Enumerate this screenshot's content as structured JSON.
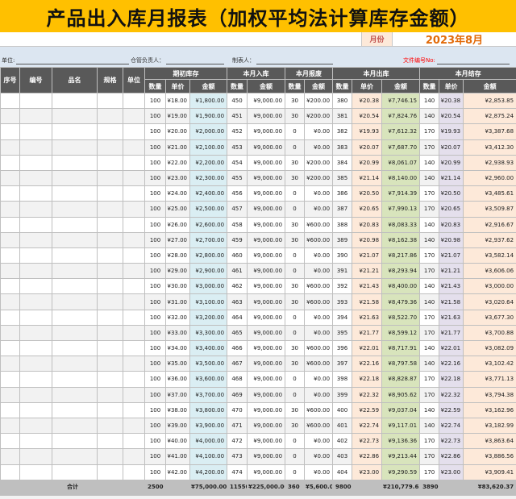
{
  "title": "产品出入库月报表（加权平均法计算库存金额）",
  "month": {
    "label": "月份",
    "value": "2023年8月"
  },
  "info": {
    "unit_label": "单位:",
    "warehouse_label": "仓管负责人：",
    "preparer_label": "制表人：",
    "doc_no_label": "文件编号No:"
  },
  "headers": {
    "seq": "序号",
    "code": "编号",
    "name": "品名",
    "spec": "规格",
    "unit": "单位",
    "begin": "期初库存",
    "in": "本月入库",
    "scrap": "本月报废",
    "out": "本月出库",
    "end": "本月结存",
    "qty": "数量",
    "price": "单价",
    "amount": "金额"
  },
  "rows": [
    {
      "bq": "100",
      "bp": "¥18.00",
      "ba": "¥1,800.00",
      "iq": "450",
      "ia": "¥9,000.00",
      "sq": "30",
      "sa": "¥200.00",
      "oq": "380",
      "op": "¥20.38",
      "oa": "¥7,746.15",
      "eq": "140",
      "ep": "¥20.38",
      "ea": "¥2,853.85"
    },
    {
      "bq": "100",
      "bp": "¥19.00",
      "ba": "¥1,900.00",
      "iq": "451",
      "ia": "¥9,000.00",
      "sq": "30",
      "sa": "¥200.00",
      "oq": "381",
      "op": "¥20.54",
      "oa": "¥7,824.76",
      "eq": "140",
      "ep": "¥20.54",
      "ea": "¥2,875.24"
    },
    {
      "bq": "100",
      "bp": "¥20.00",
      "ba": "¥2,000.00",
      "iq": "452",
      "ia": "¥9,000.00",
      "sq": "0",
      "sa": "¥0.00",
      "oq": "382",
      "op": "¥19.93",
      "oa": "¥7,612.32",
      "eq": "170",
      "ep": "¥19.93",
      "ea": "¥3,387.68"
    },
    {
      "bq": "100",
      "bp": "¥21.00",
      "ba": "¥2,100.00",
      "iq": "453",
      "ia": "¥9,000.00",
      "sq": "0",
      "sa": "¥0.00",
      "oq": "383",
      "op": "¥20.07",
      "oa": "¥7,687.70",
      "eq": "170",
      "ep": "¥20.07",
      "ea": "¥3,412.30"
    },
    {
      "bq": "100",
      "bp": "¥22.00",
      "ba": "¥2,200.00",
      "iq": "454",
      "ia": "¥9,000.00",
      "sq": "30",
      "sa": "¥200.00",
      "oq": "384",
      "op": "¥20.99",
      "oa": "¥8,061.07",
      "eq": "140",
      "ep": "¥20.99",
      "ea": "¥2,938.93"
    },
    {
      "bq": "100",
      "bp": "¥23.00",
      "ba": "¥2,300.00",
      "iq": "455",
      "ia": "¥9,000.00",
      "sq": "30",
      "sa": "¥200.00",
      "oq": "385",
      "op": "¥21.14",
      "oa": "¥8,140.00",
      "eq": "140",
      "ep": "¥21.14",
      "ea": "¥2,960.00"
    },
    {
      "bq": "100",
      "bp": "¥24.00",
      "ba": "¥2,400.00",
      "iq": "456",
      "ia": "¥9,000.00",
      "sq": "0",
      "sa": "¥0.00",
      "oq": "386",
      "op": "¥20.50",
      "oa": "¥7,914.39",
      "eq": "170",
      "ep": "¥20.50",
      "ea": "¥3,485.61"
    },
    {
      "bq": "100",
      "bp": "¥25.00",
      "ba": "¥2,500.00",
      "iq": "457",
      "ia": "¥9,000.00",
      "sq": "0",
      "sa": "¥0.00",
      "oq": "387",
      "op": "¥20.65",
      "oa": "¥7,990.13",
      "eq": "170",
      "ep": "¥20.65",
      "ea": "¥3,509.87"
    },
    {
      "bq": "100",
      "bp": "¥26.00",
      "ba": "¥2,600.00",
      "iq": "458",
      "ia": "¥9,000.00",
      "sq": "30",
      "sa": "¥600.00",
      "oq": "388",
      "op": "¥20.83",
      "oa": "¥8,083.33",
      "eq": "140",
      "ep": "¥20.83",
      "ea": "¥2,916.67"
    },
    {
      "bq": "100",
      "bp": "¥27.00",
      "ba": "¥2,700.00",
      "iq": "459",
      "ia": "¥9,000.00",
      "sq": "30",
      "sa": "¥600.00",
      "oq": "389",
      "op": "¥20.98",
      "oa": "¥8,162.38",
      "eq": "140",
      "ep": "¥20.98",
      "ea": "¥2,937.62"
    },
    {
      "bq": "100",
      "bp": "¥28.00",
      "ba": "¥2,800.00",
      "iq": "460",
      "ia": "¥9,000.00",
      "sq": "0",
      "sa": "¥0.00",
      "oq": "390",
      "op": "¥21.07",
      "oa": "¥8,217.86",
      "eq": "170",
      "ep": "¥21.07",
      "ea": "¥3,582.14"
    },
    {
      "bq": "100",
      "bp": "¥29.00",
      "ba": "¥2,900.00",
      "iq": "461",
      "ia": "¥9,000.00",
      "sq": "0",
      "sa": "¥0.00",
      "oq": "391",
      "op": "¥21.21",
      "oa": "¥8,293.94",
      "eq": "170",
      "ep": "¥21.21",
      "ea": "¥3,606.06"
    },
    {
      "bq": "100",
      "bp": "¥30.00",
      "ba": "¥3,000.00",
      "iq": "462",
      "ia": "¥9,000.00",
      "sq": "30",
      "sa": "¥600.00",
      "oq": "392",
      "op": "¥21.43",
      "oa": "¥8,400.00",
      "eq": "140",
      "ep": "¥21.43",
      "ea": "¥3,000.00"
    },
    {
      "bq": "100",
      "bp": "¥31.00",
      "ba": "¥3,100.00",
      "iq": "463",
      "ia": "¥9,000.00",
      "sq": "30",
      "sa": "¥600.00",
      "oq": "393",
      "op": "¥21.58",
      "oa": "¥8,479.36",
      "eq": "140",
      "ep": "¥21.58",
      "ea": "¥3,020.64"
    },
    {
      "bq": "100",
      "bp": "¥32.00",
      "ba": "¥3,200.00",
      "iq": "464",
      "ia": "¥9,000.00",
      "sq": "0",
      "sa": "¥0.00",
      "oq": "394",
      "op": "¥21.63",
      "oa": "¥8,522.70",
      "eq": "170",
      "ep": "¥21.63",
      "ea": "¥3,677.30"
    },
    {
      "bq": "100",
      "bp": "¥33.00",
      "ba": "¥3,300.00",
      "iq": "465",
      "ia": "¥9,000.00",
      "sq": "0",
      "sa": "¥0.00",
      "oq": "395",
      "op": "¥21.77",
      "oa": "¥8,599.12",
      "eq": "170",
      "ep": "¥21.77",
      "ea": "¥3,700.88"
    },
    {
      "bq": "100",
      "bp": "¥34.00",
      "ba": "¥3,400.00",
      "iq": "466",
      "ia": "¥9,000.00",
      "sq": "30",
      "sa": "¥600.00",
      "oq": "396",
      "op": "¥22.01",
      "oa": "¥8,717.91",
      "eq": "140",
      "ep": "¥22.01",
      "ea": "¥3,082.09"
    },
    {
      "bq": "100",
      "bp": "¥35.00",
      "ba": "¥3,500.00",
      "iq": "467",
      "ia": "¥9,000.00",
      "sq": "30",
      "sa": "¥600.00",
      "oq": "397",
      "op": "¥22.16",
      "oa": "¥8,797.58",
      "eq": "140",
      "ep": "¥22.16",
      "ea": "¥3,102.42"
    },
    {
      "bq": "100",
      "bp": "¥36.00",
      "ba": "¥3,600.00",
      "iq": "468",
      "ia": "¥9,000.00",
      "sq": "0",
      "sa": "¥0.00",
      "oq": "398",
      "op": "¥22.18",
      "oa": "¥8,828.87",
      "eq": "170",
      "ep": "¥22.18",
      "ea": "¥3,771.13"
    },
    {
      "bq": "100",
      "bp": "¥37.00",
      "ba": "¥3,700.00",
      "iq": "469",
      "ia": "¥9,000.00",
      "sq": "0",
      "sa": "¥0.00",
      "oq": "399",
      "op": "¥22.32",
      "oa": "¥8,905.62",
      "eq": "170",
      "ep": "¥22.32",
      "ea": "¥3,794.38"
    },
    {
      "bq": "100",
      "bp": "¥38.00",
      "ba": "¥3,800.00",
      "iq": "470",
      "ia": "¥9,000.00",
      "sq": "30",
      "sa": "¥600.00",
      "oq": "400",
      "op": "¥22.59",
      "oa": "¥9,037.04",
      "eq": "140",
      "ep": "¥22.59",
      "ea": "¥3,162.96"
    },
    {
      "bq": "100",
      "bp": "¥39.00",
      "ba": "¥3,900.00",
      "iq": "471",
      "ia": "¥9,000.00",
      "sq": "30",
      "sa": "¥600.00",
      "oq": "401",
      "op": "¥22.74",
      "oa": "¥9,117.01",
      "eq": "140",
      "ep": "¥22.74",
      "ea": "¥3,182.99"
    },
    {
      "bq": "100",
      "bp": "¥40.00",
      "ba": "¥4,000.00",
      "iq": "472",
      "ia": "¥9,000.00",
      "sq": "0",
      "sa": "¥0.00",
      "oq": "402",
      "op": "¥22.73",
      "oa": "¥9,136.36",
      "eq": "170",
      "ep": "¥22.73",
      "ea": "¥3,863.64"
    },
    {
      "bq": "100",
      "bp": "¥41.00",
      "ba": "¥4,100.00",
      "iq": "473",
      "ia": "¥9,000.00",
      "sq": "0",
      "sa": "¥0.00",
      "oq": "403",
      "op": "¥22.86",
      "oa": "¥9,213.44",
      "eq": "170",
      "ep": "¥22.86",
      "ea": "¥3,886.56"
    },
    {
      "bq": "100",
      "bp": "¥42.00",
      "ba": "¥4,200.00",
      "iq": "474",
      "ia": "¥9,000.00",
      "sq": "0",
      "sa": "¥0.00",
      "oq": "404",
      "op": "¥23.00",
      "oa": "¥9,290.59",
      "eq": "170",
      "ep": "¥23.00",
      "ea": "¥3,909.41"
    }
  ],
  "totals": {
    "label": "合计",
    "bq": "2500",
    "ba": "¥75,000.00",
    "iq": "11550",
    "ia": "¥225,000.00",
    "sq": "360",
    "sa": "¥5,600.00",
    "oq": "9800",
    "oa": "¥210,779.63",
    "eq": "3890",
    "ea": "¥83,620.37"
  }
}
